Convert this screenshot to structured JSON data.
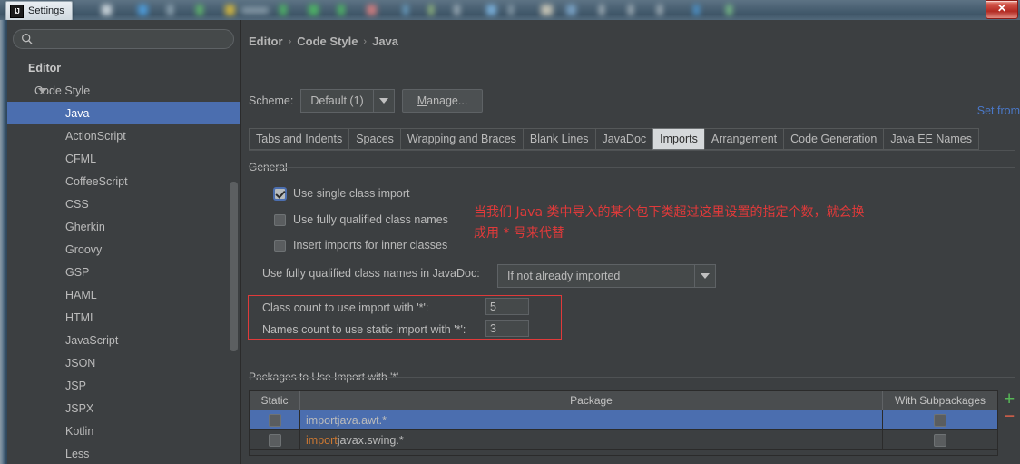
{
  "window": {
    "title": "Settings",
    "logo_text": "IJ",
    "close_label": "✕"
  },
  "sidebar": {
    "search": {
      "value": "",
      "placeholder": "",
      "icon": "search-icon"
    },
    "items": [
      {
        "label": "Editor",
        "level": 0,
        "selected": false,
        "twisty": false
      },
      {
        "label": "Code Style",
        "level": 1,
        "selected": false,
        "twisty": true
      },
      {
        "label": "Java",
        "level": 2,
        "selected": true,
        "twisty": false
      },
      {
        "label": "ActionScript",
        "level": 2,
        "selected": false,
        "twisty": false
      },
      {
        "label": "CFML",
        "level": 2,
        "selected": false,
        "twisty": false
      },
      {
        "label": "CoffeeScript",
        "level": 2,
        "selected": false,
        "twisty": false
      },
      {
        "label": "CSS",
        "level": 2,
        "selected": false,
        "twisty": false
      },
      {
        "label": "Gherkin",
        "level": 2,
        "selected": false,
        "twisty": false
      },
      {
        "label": "Groovy",
        "level": 2,
        "selected": false,
        "twisty": false
      },
      {
        "label": "GSP",
        "level": 2,
        "selected": false,
        "twisty": false
      },
      {
        "label": "HAML",
        "level": 2,
        "selected": false,
        "twisty": false
      },
      {
        "label": "HTML",
        "level": 2,
        "selected": false,
        "twisty": false
      },
      {
        "label": "JavaScript",
        "level": 2,
        "selected": false,
        "twisty": false
      },
      {
        "label": "JSON",
        "level": 2,
        "selected": false,
        "twisty": false
      },
      {
        "label": "JSP",
        "level": 2,
        "selected": false,
        "twisty": false
      },
      {
        "label": "JSPX",
        "level": 2,
        "selected": false,
        "twisty": false
      },
      {
        "label": "Kotlin",
        "level": 2,
        "selected": false,
        "twisty": false
      },
      {
        "label": "Less",
        "level": 2,
        "selected": false,
        "twisty": false
      }
    ]
  },
  "main": {
    "breadcrumb": [
      "Editor",
      "Code Style",
      "Java"
    ],
    "breadcrumb_separator": "›",
    "scheme": {
      "label": "Scheme:",
      "value": "Default (1)",
      "manage_button": "Manage...",
      "manage_mnemonic": "M",
      "manage_rest": "anage..."
    },
    "set_from_link": "Set from",
    "tabs": [
      {
        "label": "Tabs and Indents",
        "active": false
      },
      {
        "label": "Spaces",
        "active": false
      },
      {
        "label": "Wrapping and Braces",
        "active": false
      },
      {
        "label": "Blank Lines",
        "active": false
      },
      {
        "label": "JavaDoc",
        "active": false
      },
      {
        "label": "Imports",
        "active": true
      },
      {
        "label": "Arrangement",
        "active": false
      },
      {
        "label": "Code Generation",
        "active": false
      },
      {
        "label": "Java EE Names",
        "active": false
      }
    ],
    "general": {
      "title": "General",
      "checkboxes": [
        {
          "label": "Use single class import",
          "checked": true
        },
        {
          "label": "Use fully qualified class names",
          "checked": false
        },
        {
          "label": "Insert imports for inner classes",
          "checked": false
        }
      ],
      "javadoc_label": "Use fully qualified class names in JavaDoc:",
      "javadoc_value": "If not already imported",
      "counts": [
        {
          "label": "Class count to use import with '*':",
          "value": "5"
        },
        {
          "label": "Names count to use static import with '*':",
          "value": "3"
        }
      ]
    },
    "annotation": {
      "text": "当我们 Java 类中导入的某个包下类超过这里设置的指定个数，就会换\n成用 * 号来代替",
      "color": "#e03a3a"
    },
    "packages": {
      "title": "Packages to Use Import with '*'",
      "columns": [
        "Static",
        "Package",
        "With Subpackages"
      ],
      "rows": [
        {
          "static": false,
          "keyword": "import",
          "package": " java.awt.*",
          "subpackages": false,
          "selected": true,
          "keyword_highlighted": false
        },
        {
          "static": false,
          "keyword": "import",
          "package": " javax.swing.*",
          "subpackages": false,
          "selected": false,
          "keyword_highlighted": true
        }
      ],
      "add_button": "+",
      "remove_button": "−"
    }
  },
  "colors": {
    "selection": "#4b6eaf",
    "accent_red": "#e03a3a",
    "link_blue": "#4a78c8",
    "keyword_orange": "#cc7832",
    "add_green": "#56b656",
    "remove_red": "#d9604a"
  }
}
